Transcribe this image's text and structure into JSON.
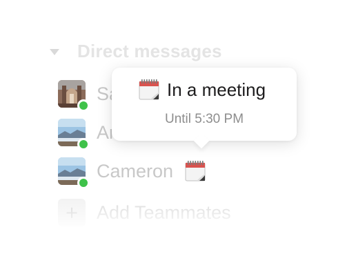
{
  "section": {
    "title": "Direct messages",
    "caret_icon": "caret-down-icon"
  },
  "dms": [
    {
      "name": "Sa",
      "avatar": "cathedral-photo",
      "presence": "active",
      "status_emoji": null
    },
    {
      "name": "An",
      "avatar": "landscape-photo",
      "presence": "active",
      "status_emoji": null
    },
    {
      "name": "Cameron",
      "avatar": "landscape-photo",
      "presence": "active",
      "status_emoji": "calendar-icon"
    }
  ],
  "add_teammates": {
    "label": "Add Teammates",
    "icon": "plus-icon",
    "icon_glyph": "+"
  },
  "tooltip": {
    "emoji": "calendar-icon",
    "status": "In a meeting",
    "until": "Until 5:30 PM"
  },
  "colors": {
    "presence_active": "#3fc24a",
    "tooltip_text": "#1d1c1d",
    "muted_text": "#8d8d8d"
  }
}
